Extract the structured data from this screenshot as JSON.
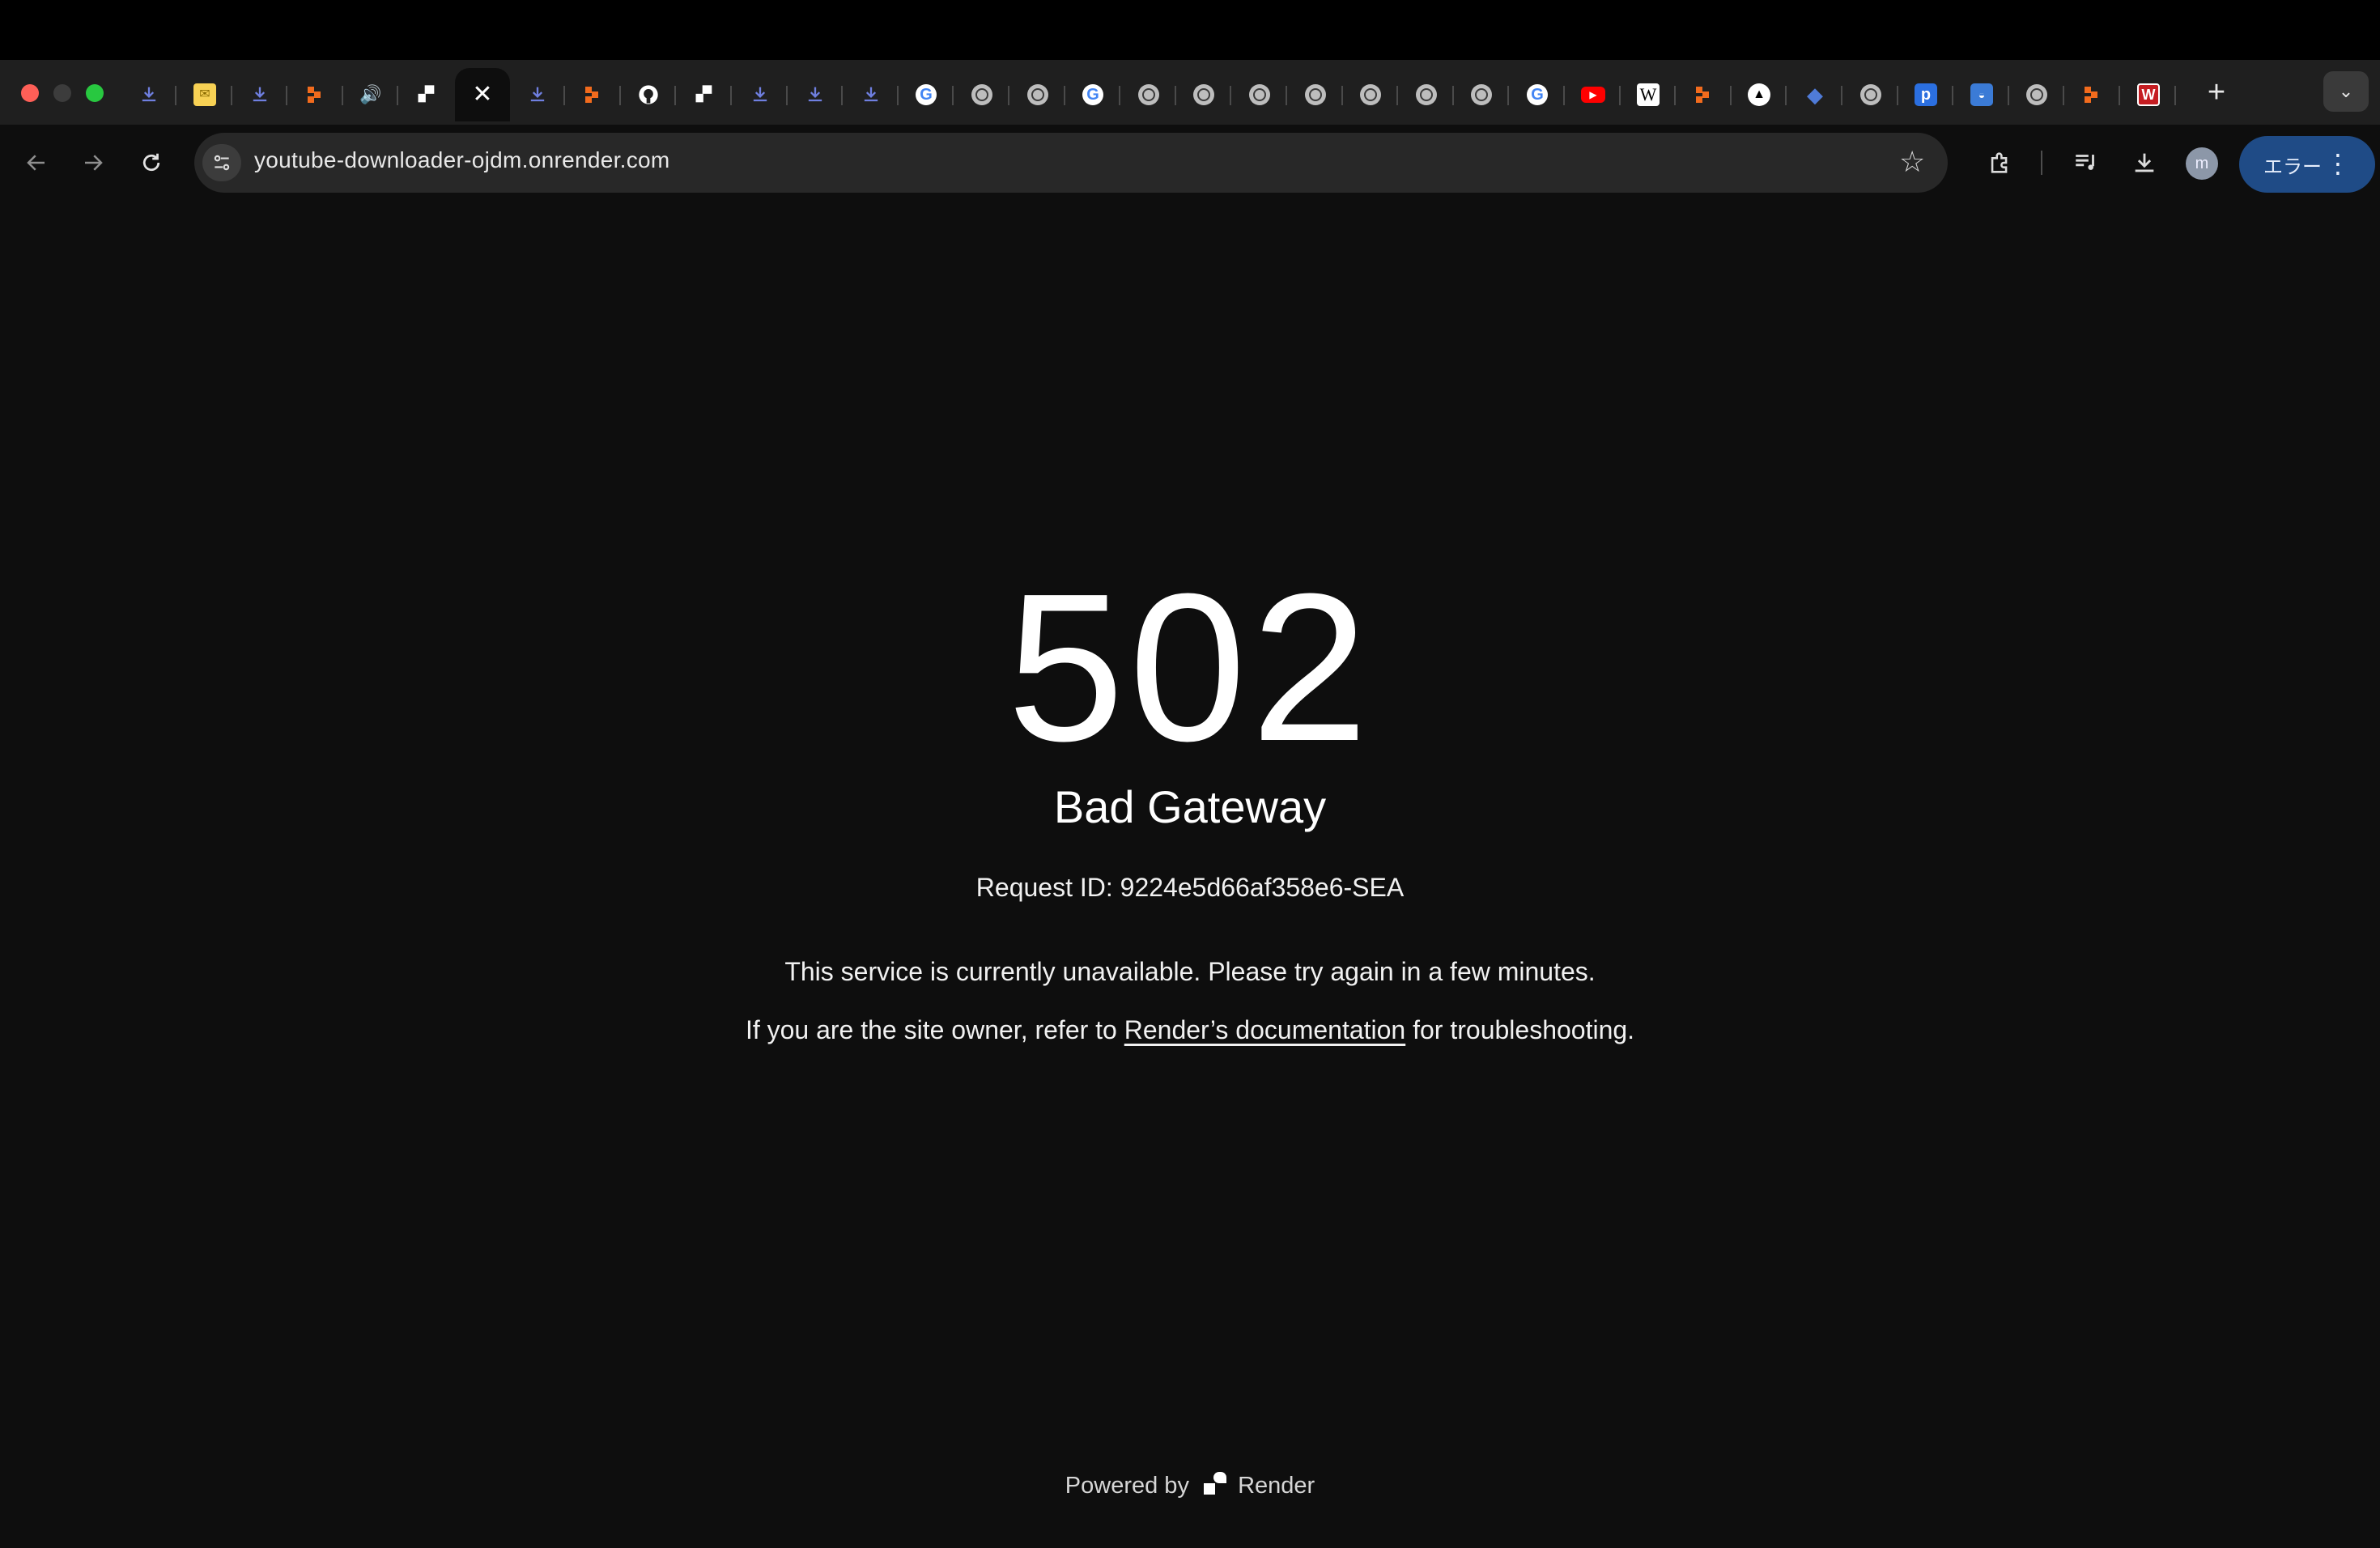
{
  "browser": {
    "url": "youtube-downloader-ojdm.onrender.com",
    "profile_initial": "m",
    "error_pill_label": "エラー",
    "new_tab_glyph": "+",
    "tab_search_glyph": "⌄",
    "star_glyph": "☆",
    "menu_glyph": "⋮",
    "tab_favicons": [
      "download-icon",
      "sticky-note-icon",
      "download-icon",
      "orange-blocks-icon",
      "speaker-icon",
      "render-icon",
      "close-icon",
      "download-icon",
      "orange-blocks-icon",
      "github-icon",
      "render-icon",
      "download-icon",
      "download-icon",
      "download-icon",
      "google-icon",
      "globe-icon",
      "globe-icon",
      "google-icon",
      "globe-icon",
      "globe-icon",
      "globe-icon",
      "globe-icon",
      "globe-icon",
      "globe-icon",
      "globe-icon",
      "google-icon",
      "youtube-icon",
      "wikipedia-icon",
      "orange-blocks-icon",
      "triangle-icon",
      "blue-diamond-icon",
      "globe-icon",
      "blue-p-icon",
      "blue-chat-icon",
      "globe-icon",
      "orange-blocks-icon",
      "red-w-icon"
    ]
  },
  "page": {
    "status_code": "502",
    "status_text": "Bad Gateway",
    "request_id_label": "Request ID: 9224e5d66af358e6-SEA",
    "message": "This service is currently unavailable. Please try again in a few minutes.",
    "owner_prefix": "If you are the site owner, refer to ",
    "docs_link": "Render’s documentation",
    "owner_suffix": " for troubleshooting.",
    "footer_prefix": "Powered by",
    "footer_brand": "Render"
  }
}
